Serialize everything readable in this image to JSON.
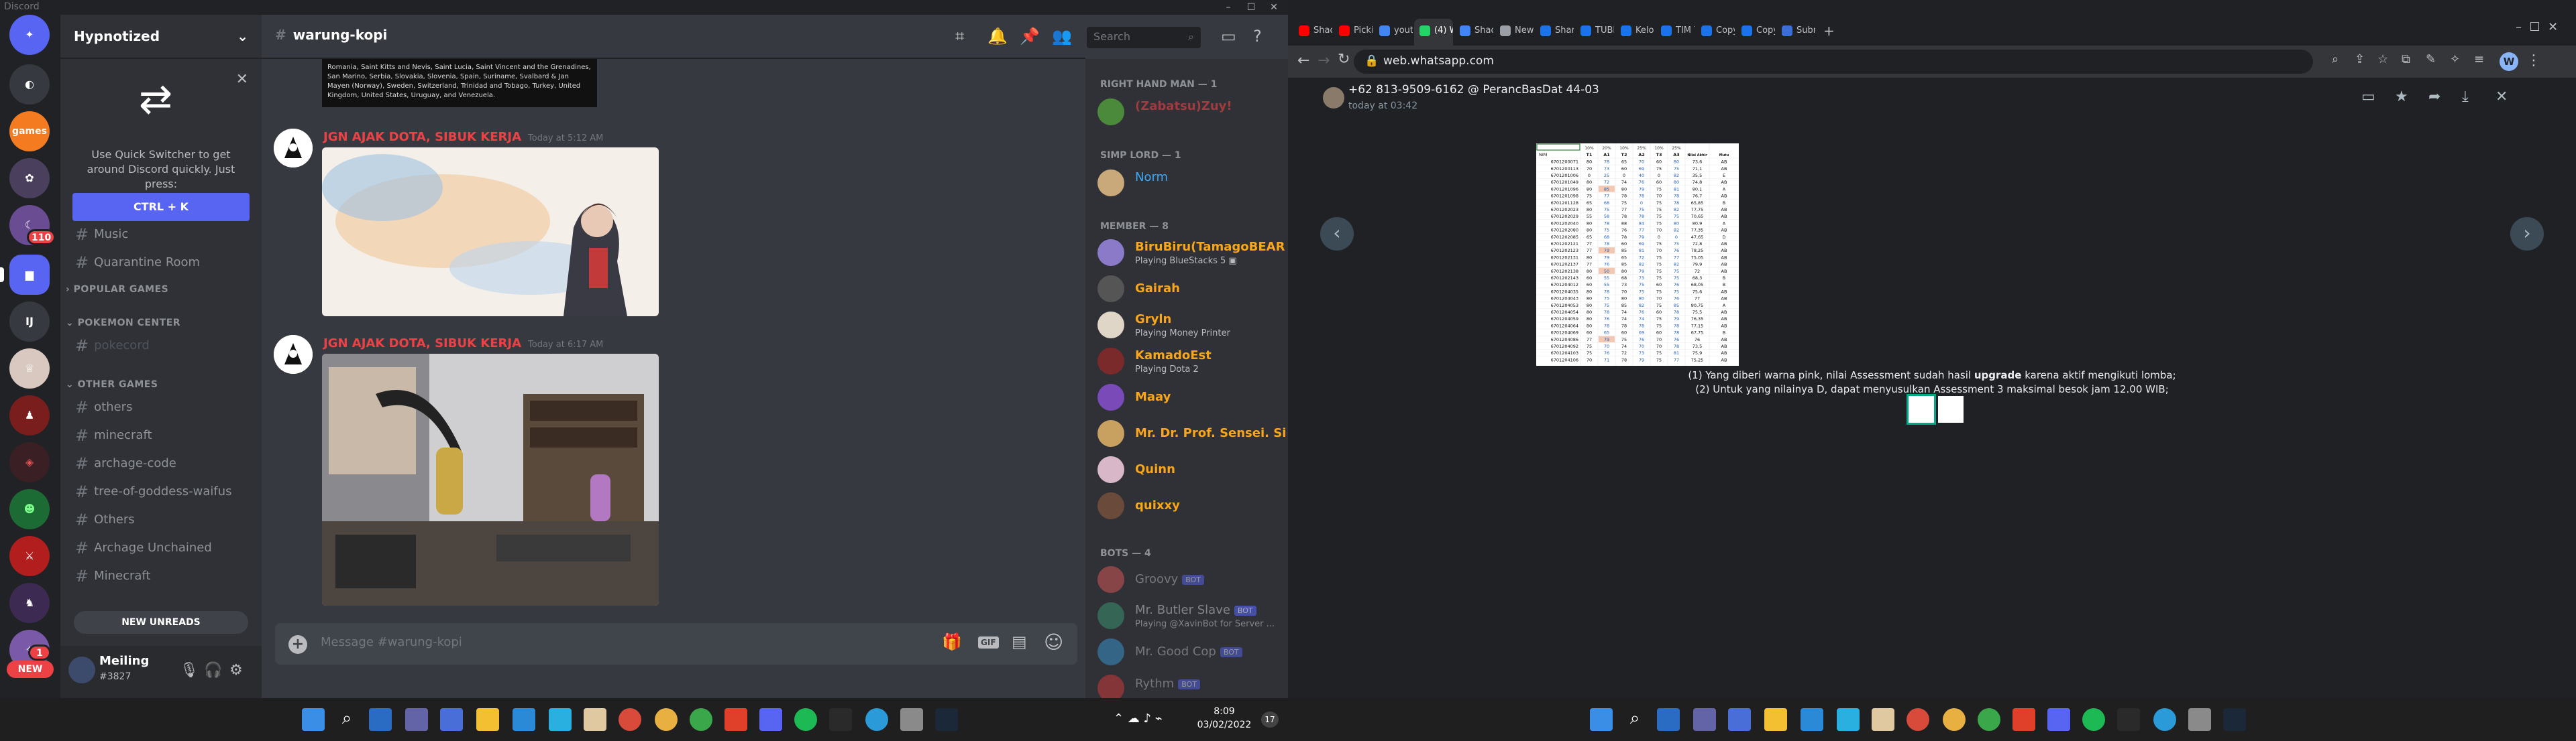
{
  "discord": {
    "app_title": "Discord",
    "window_controls": [
      "–",
      "☐",
      "✕"
    ],
    "guild_badges": {
      "one": "110",
      "two": "1",
      "new": "NEW"
    },
    "guild_labels": {
      "games": "games",
      "ij": "IJ"
    },
    "server_name": "Hypnotized",
    "quick_switcher": {
      "text": "Use Quick Switcher to get around Discord quickly. Just press:",
      "button": "CTRL + K"
    },
    "channels_top": [
      "Music",
      "Quarantine Room"
    ],
    "categories": {
      "popular": "POPULAR GAMES",
      "pokemon": "POKEMON CENTER",
      "other": "OTHER GAMES"
    },
    "pokemon_channels": [
      "pokecord"
    ],
    "other_channels": [
      "others",
      "minecraft",
      "archage-code",
      "tree-of-goddess-waifus",
      "Others",
      "Archage Unchained",
      "Minecraft"
    ],
    "new_unreads": "NEW UNREADS",
    "user": {
      "name": "Meiling",
      "tag": "#3827"
    },
    "channel_title": "warung-kopi",
    "search_placeholder": "Search",
    "countries_text": "Romania, Saint Kitts and Nevis, Saint Lucia, Saint Vincent and the Grenadines, San Marino, Serbia, Slovakia, Slovenia, Spain, Suriname, Svalbard & Jan Mayen (Norway), Sweden, Switzerland, Trinidad and Tobago, Turkey, United Kingdom, United States, Uruguay, and Venezuela.",
    "messages": [
      {
        "author": "JGN AJAK DOTA, SIBUK KERJA",
        "time": "Today at 5:12 AM"
      },
      {
        "author": "JGN AJAK DOTA, SIBUK KERJA",
        "time": "Today at 6:17 AM"
      }
    ],
    "message_placeholder": "Message #warung-kopi",
    "input_icons": {
      "gift": "🎁",
      "gif": "GIF",
      "sticker": "▤",
      "emoji": "☺",
      "add": "+"
    },
    "members": {
      "right_hand": "RIGHT HAND MAN — 1",
      "right_hand_member": "(Zabatsu)Zuy!",
      "simp": "SIMP LORD — 1",
      "simp_member": "Norm",
      "member_cat": "MEMBER — 8",
      "list": [
        {
          "name": "BiruBiru(TamagoBEAR)",
          "activity": "Playing BlueStacks 5 ▣",
          "color": "#faa61a"
        },
        {
          "name": "Gairah",
          "activity": "",
          "color": "#faa61a"
        },
        {
          "name": "Gryln",
          "activity": "Playing Money Printer",
          "color": "#faa61a"
        },
        {
          "name": "KamadoEst",
          "activity": "Playing Dota 2",
          "color": "#faa61a"
        },
        {
          "name": "Maay",
          "activity": "",
          "color": "#faa61a"
        },
        {
          "name": "Mr. Dr. Prof. Sensei. Si...",
          "activity": "",
          "color": "#faa61a"
        },
        {
          "name": "Quinn",
          "activity": "",
          "color": "#faa61a"
        },
        {
          "name": "quixxy",
          "activity": "",
          "color": "#faa61a"
        }
      ],
      "bots_cat": "BOTS — 4",
      "bots": [
        {
          "name": "Groovy",
          "activity": ""
        },
        {
          "name": "Mr. Butler Slave",
          "activity": "Playing @XavinBot for Server ..."
        },
        {
          "name": "Mr. Good Cop",
          "activity": ""
        },
        {
          "name": "Rythm",
          "activity": ""
        }
      ],
      "bot_label": "BOT"
    },
    "taskbar": {
      "time": "8:09",
      "date": "03/02/2022",
      "notif": "17"
    }
  },
  "chrome": {
    "tabs": [
      "Shado",
      "Pickin",
      "youtu",
      "(4) W",
      "Shado",
      "New T",
      "Share",
      "TUBE",
      "Kelom",
      "TIM T",
      "Copy",
      "Copy",
      "Subm"
    ],
    "url": "web.whatsapp.com",
    "profile_initial": "W",
    "viewer": {
      "sender": "+62 813-9509-6162 @ PerancBasDat 44-03",
      "time": "today at 03:42"
    },
    "caption_line1_pre": "(1) Yang diberi warna pink, nilai Assessment sudah hasil",
    "caption_line1_bold": "upgrade",
    "caption_line1_post": "karena aktif mengikuti lomba;",
    "caption_line2": "(2) Untuk yang nilainya D, dapat menyusulkan Assessment 3 maksimal besok jam 12.00 WIB;",
    "taskbar": {
      "time": "8:09",
      "date": "03/02/2022"
    }
  },
  "sheet": {
    "percents": [
      "10%",
      "20%",
      "10%",
      "25%",
      "10%",
      "25%"
    ],
    "headers": [
      "NIM",
      "T1",
      "A1",
      "T2",
      "A2",
      "T3",
      "A3",
      "Nilai Akhir",
      "Mutu"
    ],
    "rows": [
      [
        "6701200071",
        "80",
        "78",
        "65",
        "70",
        "60",
        "80",
        "73,6",
        "AB"
      ],
      [
        "6701200113",
        "70",
        "73",
        "60",
        "69",
        "75",
        "75",
        "71,1",
        "AB"
      ],
      [
        "6701201006",
        "0",
        "25",
        "0",
        "40",
        "0",
        "82",
        "35,5",
        "E"
      ],
      [
        "6701201049",
        "80",
        "72",
        "74",
        "76",
        "60",
        "80",
        "74,8",
        "AB"
      ],
      [
        "6701201096",
        "80",
        "85",
        "80",
        "79",
        "75",
        "81",
        "80,1",
        "A"
      ],
      [
        "6701201098",
        "75",
        "77",
        "78",
        "78",
        "70",
        "78",
        "76,7",
        "AB"
      ],
      [
        "6701201128",
        "65",
        "68",
        "75",
        "0",
        "75",
        "78",
        "65,85",
        "B"
      ],
      [
        "6701202023",
        "80",
        "75",
        "77",
        "75",
        "75",
        "82",
        "77,75",
        "AB"
      ],
      [
        "6701202029",
        "55",
        "58",
        "78",
        "78",
        "75",
        "75",
        "70,65",
        "AB"
      ],
      [
        "6701202040",
        "80",
        "78",
        "88",
        "84",
        "75",
        "80",
        "80,9",
        "A"
      ],
      [
        "6701202080",
        "80",
        "75",
        "76",
        "77",
        "70",
        "82",
        "77,35",
        "AB"
      ],
      [
        "6701202085",
        "65",
        "68",
        "78",
        "79",
        "0",
        "0",
        "47,65",
        "D"
      ],
      [
        "6701202121",
        "77",
        "78",
        "60",
        "69",
        "75",
        "75",
        "72,8",
        "AB"
      ],
      [
        "6701202123",
        "77",
        "79",
        "85",
        "81",
        "70",
        "76",
        "78,25",
        "AB"
      ],
      [
        "6701202131",
        "80",
        "79",
        "65",
        "72",
        "75",
        "77",
        "75,05",
        "AB"
      ],
      [
        "6701202137",
        "77",
        "76",
        "85",
        "82",
        "75",
        "82",
        "79,9",
        "AB"
      ],
      [
        "6701202138",
        "80",
        "50",
        "80",
        "79",
        "75",
        "75",
        "72",
        "AB"
      ],
      [
        "6701202143",
        "60",
        "55",
        "68",
        "73",
        "75",
        "75",
        "68,3",
        "B"
      ],
      [
        "6701204012",
        "60",
        "55",
        "73",
        "75",
        "60",
        "76",
        "68,05",
        "B"
      ],
      [
        "6701204035",
        "80",
        "78",
        "70",
        "75",
        "75",
        "75",
        "75,6",
        "AB"
      ],
      [
        "6701204043",
        "80",
        "75",
        "80",
        "80",
        "70",
        "76",
        "77",
        "AB"
      ],
      [
        "6701204053",
        "80",
        "75",
        "85",
        "82",
        "75",
        "85",
        "80,75",
        "A"
      ],
      [
        "6701204054",
        "80",
        "78",
        "74",
        "76",
        "60",
        "78",
        "75,5",
        "AB"
      ],
      [
        "6701204059",
        "80",
        "76",
        "74",
        "74",
        "75",
        "79",
        "76,35",
        "AB"
      ],
      [
        "6701204064",
        "80",
        "78",
        "78",
        "78",
        "75",
        "78",
        "77,15",
        "AB"
      ],
      [
        "6701204069",
        "60",
        "65",
        "60",
        "69",
        "60",
        "78",
        "67,75",
        "B"
      ],
      [
        "6701204086",
        "77",
        "79",
        "75",
        "76",
        "70",
        "76",
        "76",
        "AB"
      ],
      [
        "6701204092",
        "75",
        "70",
        "74",
        "70",
        "70",
        "78",
        "73,5",
        "AB"
      ],
      [
        "6701204103",
        "75",
        "76",
        "72",
        "73",
        "75",
        "81",
        "75,9",
        "AB"
      ],
      [
        "6701204106",
        "70",
        "71",
        "78",
        "79",
        "75",
        "77",
        "75,25",
        "AB"
      ]
    ],
    "pink_rows": [
      4,
      13,
      16,
      26
    ]
  }
}
